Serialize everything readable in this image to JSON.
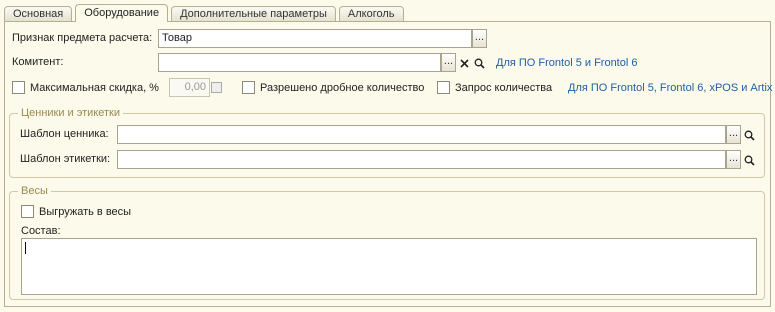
{
  "tabs": [
    {
      "label": "Основная"
    },
    {
      "label": "Оборудование"
    },
    {
      "label": "Дополнительные параметры"
    },
    {
      "label": "Алкоголь"
    }
  ],
  "active_tab": "Оборудование",
  "fields": {
    "payment_subject": {
      "label": "Признак предмета расчета:",
      "value": "Товар",
      "button": "..."
    },
    "committent": {
      "label": "Комитент:",
      "value": "",
      "button": "...",
      "link": "Для ПО Frontol 5 и Frontol 6"
    },
    "max_discount": {
      "label": "Максимальная скидка, %",
      "value": "0,00"
    },
    "fractional_qty": {
      "label": "Разрешено дробное количество"
    },
    "qty_request": {
      "label": "Запрос количества"
    },
    "frontol_link": "Для ПО Frontol 5, Frontol 6, xPOS и Artix"
  },
  "labels_group": {
    "title": "Ценники и этикетки",
    "price_tag_template": {
      "label": "Шаблон ценника:",
      "value": "",
      "button": "..."
    },
    "label_template": {
      "label": "Шаблон этикетки:",
      "value": "",
      "button": "..."
    }
  },
  "scales_group": {
    "title": "Весы",
    "upload_to_scales": {
      "label": "Выгружать в весы"
    },
    "composition": {
      "label": "Состав:",
      "value": ""
    }
  },
  "colors": {
    "background": "#fbfaeb",
    "link": "#1f5ea9",
    "group_title": "#9a8a4e"
  }
}
